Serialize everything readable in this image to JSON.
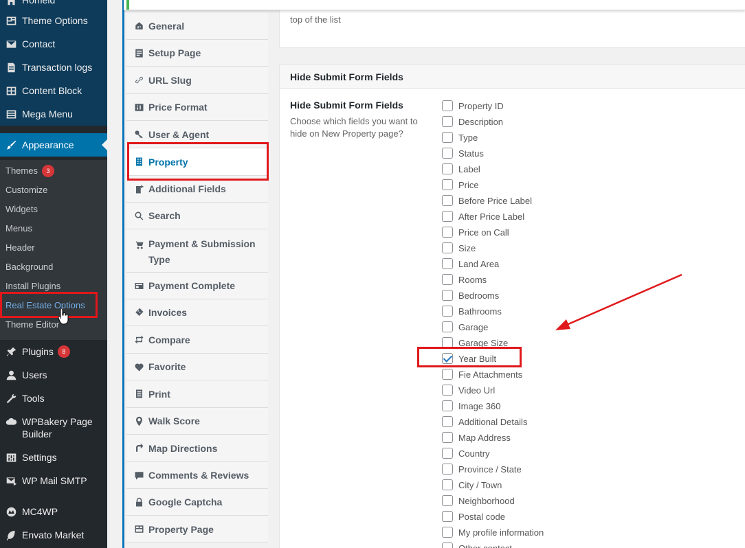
{
  "sidebar": {
    "items": [
      {
        "label": "Homeid",
        "icon": "home-icon"
      },
      {
        "label": "Theme Options",
        "icon": "theme-options-icon"
      },
      {
        "label": "Contact",
        "icon": "mail-icon"
      },
      {
        "label": "Transaction logs",
        "icon": "document-icon"
      },
      {
        "label": "Content Block",
        "icon": "grid-icon"
      },
      {
        "label": "Mega Menu",
        "icon": "list-icon"
      },
      {
        "label": "Appearance",
        "icon": "paintbrush-icon"
      },
      {
        "label": "Plugins",
        "icon": "plugin-icon",
        "badge": "8"
      },
      {
        "label": "Users",
        "icon": "user-icon"
      },
      {
        "label": "Tools",
        "icon": "wrench-icon"
      },
      {
        "label": "WPBakery Page Builder",
        "icon": "cloud-icon"
      },
      {
        "label": "Settings",
        "icon": "settings-icon"
      },
      {
        "label": "WP Mail SMTP",
        "icon": "mail-send-icon"
      },
      {
        "label": "MC4WP",
        "icon": "mc4wp-icon"
      },
      {
        "label": "Envato Market",
        "icon": "leaf-icon"
      }
    ],
    "appearance_submenu": [
      {
        "label": "Themes",
        "badge": "3"
      },
      {
        "label": "Customize"
      },
      {
        "label": "Widgets"
      },
      {
        "label": "Menus"
      },
      {
        "label": "Header"
      },
      {
        "label": "Background"
      },
      {
        "label": "Install Plugins"
      },
      {
        "label": "Real Estate Options"
      },
      {
        "label": "Theme Editor"
      }
    ]
  },
  "tabs": [
    {
      "label": "General",
      "icon": "house-icon"
    },
    {
      "label": "Setup Page",
      "icon": "setup-page-icon"
    },
    {
      "label": "URL Slug",
      "icon": "link-icon"
    },
    {
      "label": "Price Format",
      "icon": "price-icon"
    },
    {
      "label": "User & Agent",
      "icon": "key-icon"
    },
    {
      "label": "Property",
      "icon": "building-icon"
    },
    {
      "label": "Additional Fields",
      "icon": "additional-fields-icon"
    },
    {
      "label": "Search",
      "icon": "search-icon"
    },
    {
      "label": "Payment & Submission Type",
      "icon": "cart-icon"
    },
    {
      "label": "Payment Complete",
      "icon": "payment-complete-icon"
    },
    {
      "label": "Invoices",
      "icon": "invoice-icon"
    },
    {
      "label": "Compare",
      "icon": "compare-icon"
    },
    {
      "label": "Favorite",
      "icon": "heart-icon"
    },
    {
      "label": "Print",
      "icon": "print-icon"
    },
    {
      "label": "Walk Score",
      "icon": "walk-icon"
    },
    {
      "label": "Map Directions",
      "icon": "directions-icon"
    },
    {
      "label": "Comments & Reviews",
      "icon": "comments-icon"
    },
    {
      "label": "Google Captcha",
      "icon": "lock-icon"
    },
    {
      "label": "Property Page",
      "icon": "property-page-icon"
    }
  ],
  "content": {
    "top_text": "top of the list",
    "section_title": "Hide Submit Form Fields",
    "field_title": "Hide Submit Form Fields",
    "field_desc": "Choose which fields you want to hide on New Property page?",
    "fields": [
      {
        "label": "Property ID",
        "checked": false
      },
      {
        "label": "Description",
        "checked": false
      },
      {
        "label": "Type",
        "checked": false
      },
      {
        "label": "Status",
        "checked": false
      },
      {
        "label": "Label",
        "checked": false
      },
      {
        "label": "Price",
        "checked": false
      },
      {
        "label": "Before Price Label",
        "checked": false
      },
      {
        "label": "After Price Label",
        "checked": false
      },
      {
        "label": "Price on Call",
        "checked": false
      },
      {
        "label": "Size",
        "checked": false
      },
      {
        "label": "Land Area",
        "checked": false
      },
      {
        "label": "Rooms",
        "checked": false
      },
      {
        "label": "Bedrooms",
        "checked": false
      },
      {
        "label": "Bathrooms",
        "checked": false
      },
      {
        "label": "Garage",
        "checked": false
      },
      {
        "label": "Garage Size",
        "checked": false
      },
      {
        "label": "Year Built",
        "checked": true
      },
      {
        "label": "Fie Attachments",
        "checked": false
      },
      {
        "label": "Video Url",
        "checked": false
      },
      {
        "label": "Image 360",
        "checked": false
      },
      {
        "label": "Additional Details",
        "checked": false
      },
      {
        "label": "Map Address",
        "checked": false
      },
      {
        "label": "Country",
        "checked": false
      },
      {
        "label": "Province / State",
        "checked": false
      },
      {
        "label": "City / Town",
        "checked": false
      },
      {
        "label": "Neighborhood",
        "checked": false
      },
      {
        "label": "Postal code",
        "checked": false
      },
      {
        "label": "My profile information",
        "checked": false
      },
      {
        "label": "Other contact",
        "checked": false
      }
    ]
  },
  "colors": {
    "admin_bar": "#23282d",
    "accent": "#0073aa",
    "highlight": "#e0181b",
    "badge": "#d63638"
  }
}
